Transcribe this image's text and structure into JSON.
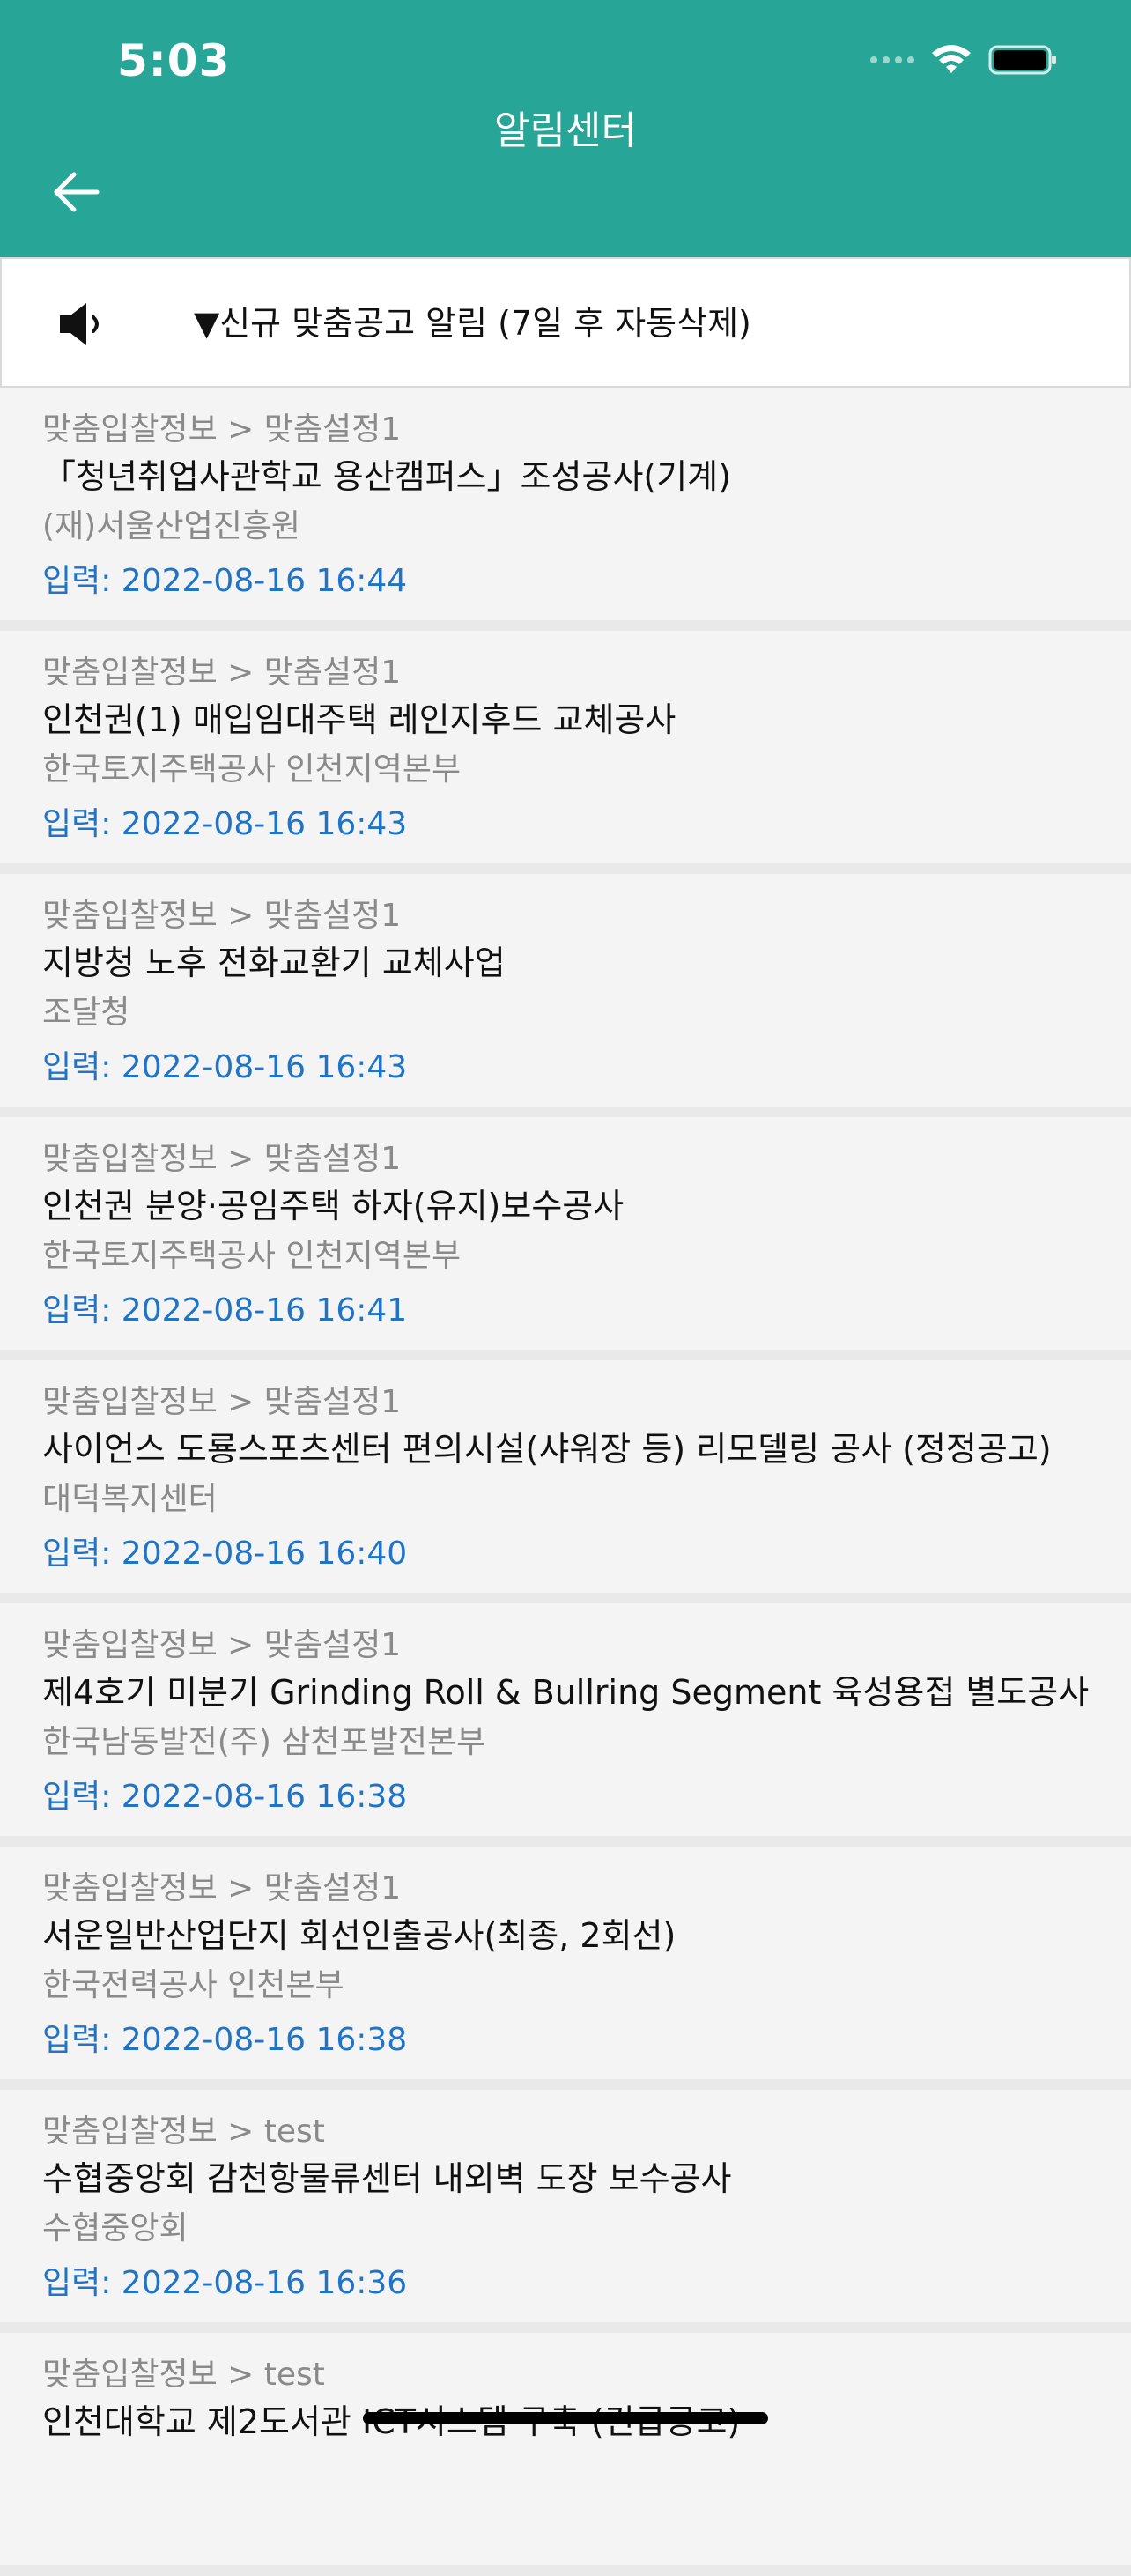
{
  "status_bar": {
    "time": "5:03"
  },
  "header": {
    "title": "알림센터"
  },
  "notice": {
    "text": "▼신규 맞춤공고 알림 (7일 후 자동삭제)"
  },
  "items": [
    {
      "category": "맞춤입찰정보 > 맞춤설정1",
      "title": "「청년취업사관학교 용산캠퍼스」조성공사(기계)",
      "org": "(재)서울산업진흥원",
      "date": "입력: 2022-08-16 16:44"
    },
    {
      "category": "맞춤입찰정보 > 맞춤설정1",
      "title": "인천권(1) 매입임대주택 레인지후드 교체공사",
      "org": "한국토지주택공사 인천지역본부",
      "date": "입력: 2022-08-16 16:43"
    },
    {
      "category": "맞춤입찰정보 > 맞춤설정1",
      "title": "지방청 노후 전화교환기 교체사업",
      "org": "조달청",
      "date": "입력: 2022-08-16 16:43"
    },
    {
      "category": "맞춤입찰정보 > 맞춤설정1",
      "title": "인천권 분양·공임주택 하자(유지)보수공사",
      "org": "한국토지주택공사 인천지역본부",
      "date": "입력: 2022-08-16 16:41"
    },
    {
      "category": "맞춤입찰정보 > 맞춤설정1",
      "title": "사이언스 도룡스포츠센터 편의시설(샤워장 등) 리모델링 공사 (정정공고)",
      "org": "대덕복지센터",
      "date": "입력: 2022-08-16 16:40"
    },
    {
      "category": "맞춤입찰정보 > 맞춤설정1",
      "title": "제4호기 미분기 Grinding Roll & Bullring Segment 육성용접 별도공사",
      "org": "한국남동발전(주) 삼천포발전본부",
      "date": "입력: 2022-08-16 16:38"
    },
    {
      "category": "맞춤입찰정보 > 맞춤설정1",
      "title": "서운일반산업단지 회선인출공사(최종, 2회선)",
      "org": "한국전력공사 인천본부",
      "date": "입력: 2022-08-16 16:38"
    },
    {
      "category": "맞춤입찰정보 > test",
      "title": "수협중앙회 감천항물류센터 내외벽 도장 보수공사",
      "org": "수협중앙회",
      "date": "입력: 2022-08-16 16:36"
    },
    {
      "category": "맞춤입찰정보 > test",
      "title": "인천대학교 제2도서관 ICT시스템 구축 (긴급공고)",
      "org": "",
      "date": ""
    }
  ]
}
